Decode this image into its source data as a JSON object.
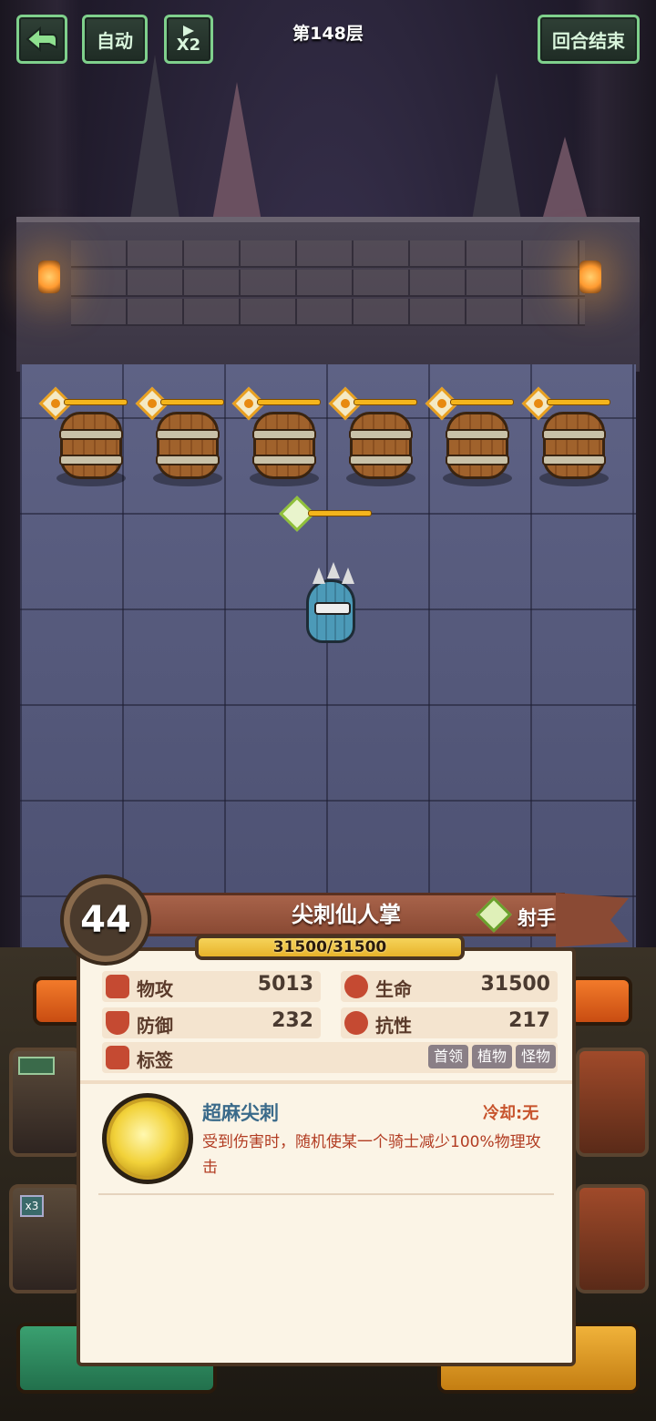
{
  "hud": {
    "back_label": "",
    "auto_label": "自动",
    "speed_label": "X2",
    "floor_title": "第148层",
    "end_turn_label": "回合结束"
  },
  "enemy_card": {
    "level": "44",
    "name": "尖刺仙人掌",
    "class_label": "射手",
    "hp_text": "31500/31500",
    "stats": {
      "attack_label": "物攻",
      "attack_value": "5013",
      "hp_label": "生命",
      "hp_value": "31500",
      "defense_label": "防御",
      "defense_value": "232",
      "resist_label": "抗性",
      "resist_value": "217",
      "tags_label": "标签"
    },
    "tags": [
      "首领",
      "植物",
      "怪物"
    ],
    "skill": {
      "name": "超麻尖刺",
      "cooldown": "冷却:无",
      "description": "受到伤害时，随机使某一个骑士减少100%物理攻击"
    }
  },
  "side_cards": {
    "left_top_badge": "",
    "left_bottom_badge": "x3"
  },
  "colors": {
    "hud_border": "#7fd08c",
    "hp_bar": "#f4b51c",
    "skill_desc": "#b23c22",
    "skill_name": "#3a6a8a"
  }
}
